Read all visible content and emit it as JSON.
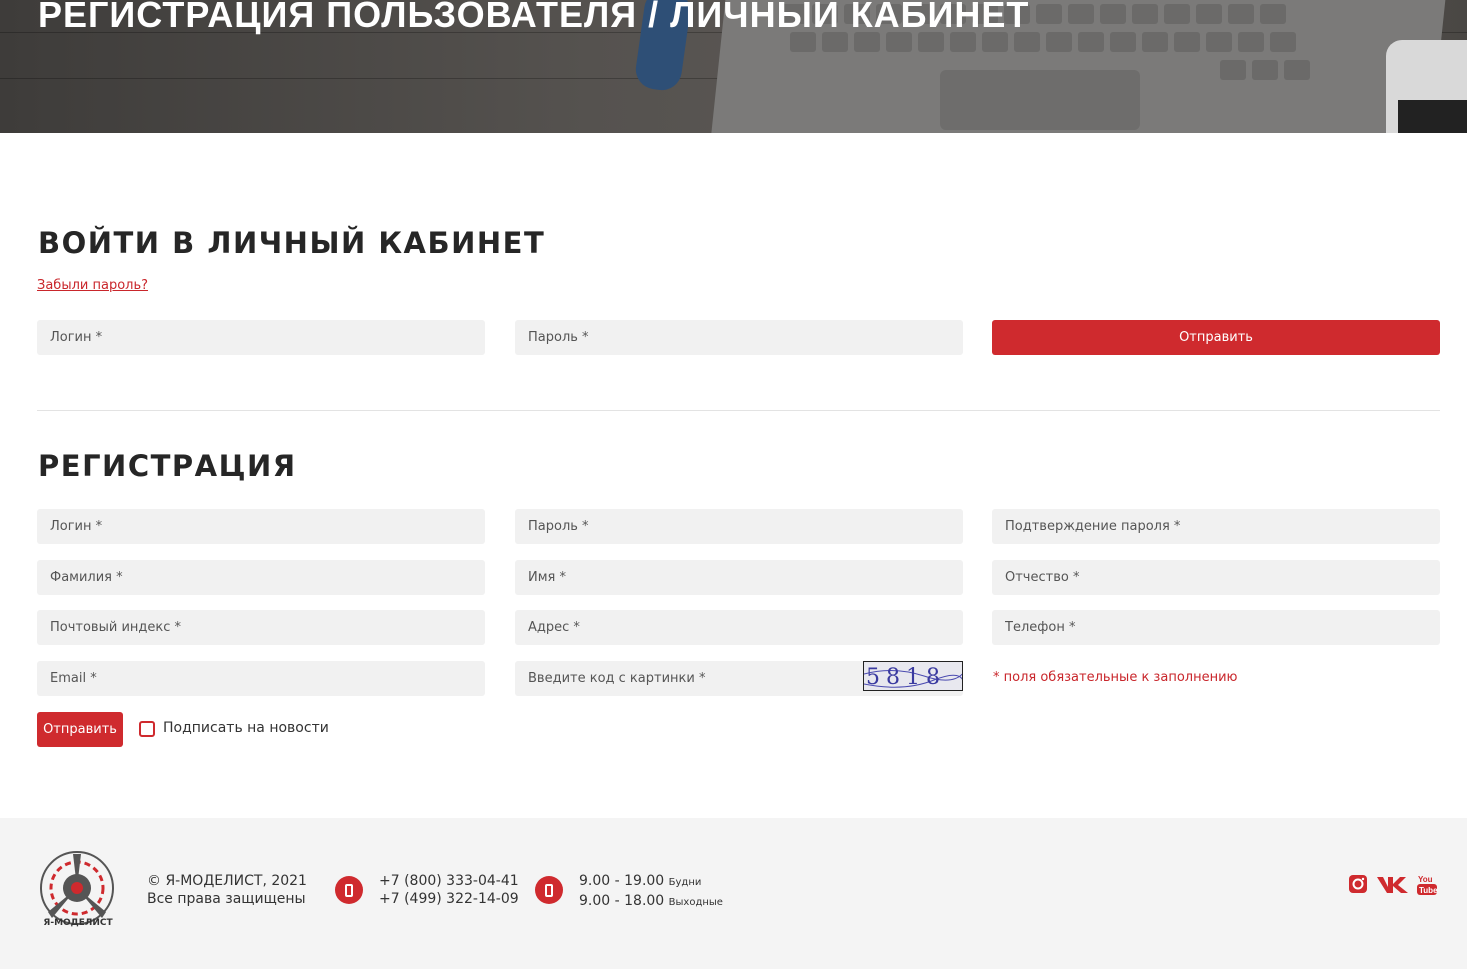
{
  "hero": {
    "title": "РЕГИСТРАЦИЯ ПОЛЬЗОВАТЕЛЯ / ЛИЧНЫЙ КАБИНЕТ"
  },
  "login": {
    "title": "ВОЙТИ В ЛИЧНЫЙ КАБИНЕТ",
    "forgot_link": "Забыли пароль?",
    "login_placeholder": "Логин *",
    "password_placeholder": "Пароль *",
    "submit_label": "Отправить"
  },
  "register": {
    "title": "РЕГИСТРАЦИЯ",
    "fields": {
      "login": "Логин *",
      "password": "Пароль *",
      "password_confirm": "Подтверждение пароля *",
      "last_name": "Фамилия *",
      "first_name": "Имя *",
      "middle_name": "Отчество *",
      "postal_code": "Почтовый индекс *",
      "address": "Адрес *",
      "phone": "Телефон *",
      "email": "Email *",
      "captcha": "Введите код с картинки *"
    },
    "captcha_code": "5818",
    "required_note": "* поля обязательные к заполнению",
    "submit_label": "Отправить",
    "subscribe_label": "Подписать на новости",
    "subscribe_checked": false
  },
  "footer": {
    "logo_text": "Я-МОДЕЛИСТ",
    "copyright": "© Я-МОДЕЛИСТ, 2021",
    "rights": "Все права защищены",
    "phone1": "+7 (800) 333-04-41",
    "phone2": "+7 (499) 322-14-09",
    "hours1_time": "9.00 - 19.00",
    "hours1_label": "Будни",
    "hours2_time": "9.00 - 18.00",
    "hours2_label": "Выходные",
    "social": [
      "instagram-icon",
      "vk-icon",
      "youtube-icon"
    ]
  },
  "colors": {
    "accent": "#cf2a2e",
    "field_bg": "#f1f1f1",
    "footer_bg": "#f4f4f4"
  }
}
